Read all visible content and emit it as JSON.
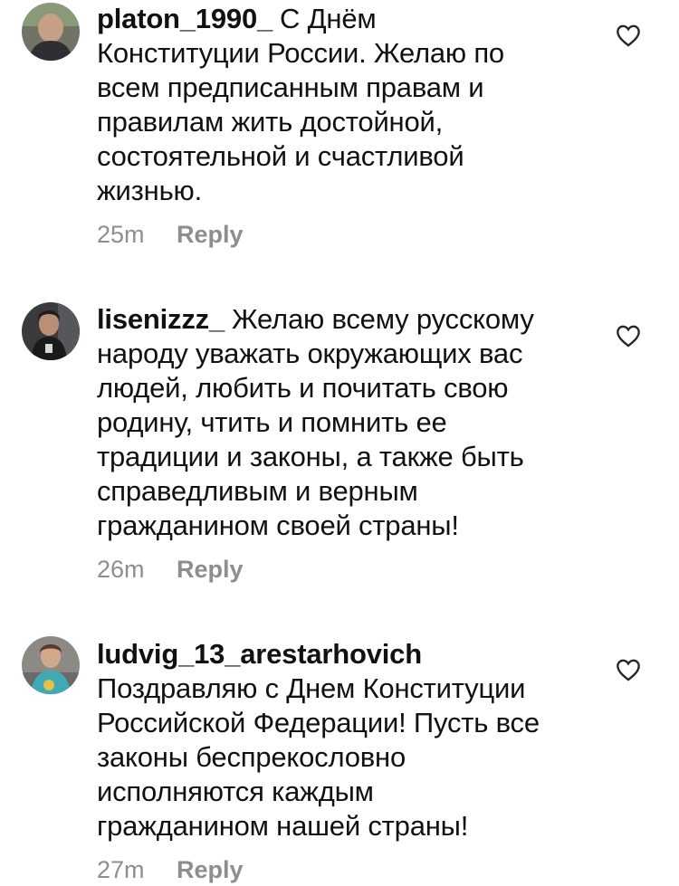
{
  "comments": [
    {
      "username": "platon_1990_",
      "lines": [
        "С Днём",
        "Конституции России. Желаю по",
        "всем предписанным правам и",
        "правилам жить достойной,",
        "состоятельной и счастливой",
        "жизнью."
      ],
      "time": "25m",
      "reply_label": "Reply",
      "avatar_icon": "avatar-photo-man",
      "like_icon": "heart-outline-icon"
    },
    {
      "username": "lisenizzz_",
      "lines": [
        "Желаю всему русскому",
        "народу уважать окружающих вас",
        "людей, любить и почитать свою",
        "родину, чтить и помнить ее",
        "традиции и законы, а также быть",
        "справедливым и верным",
        "гражданином своей страны!"
      ],
      "time": "26m",
      "reply_label": "Reply",
      "avatar_icon": "avatar-photo-man-dark",
      "like_icon": "heart-outline-icon"
    },
    {
      "username": "ludvig_13_arestarhovich",
      "lines": [
        "",
        "Поздравляю с Днем Конституции",
        "Российской Федерации! Пусть все",
        "законы беспрекословно",
        "исполняются каждым",
        "гражданином нашей страны!"
      ],
      "time": "27m",
      "reply_label": "Reply",
      "avatar_icon": "avatar-photo-boy",
      "like_icon": "heart-outline-icon"
    }
  ],
  "colors": {
    "text": "#111111",
    "meta": "#8e8e8e",
    "background": "#ffffff"
  }
}
